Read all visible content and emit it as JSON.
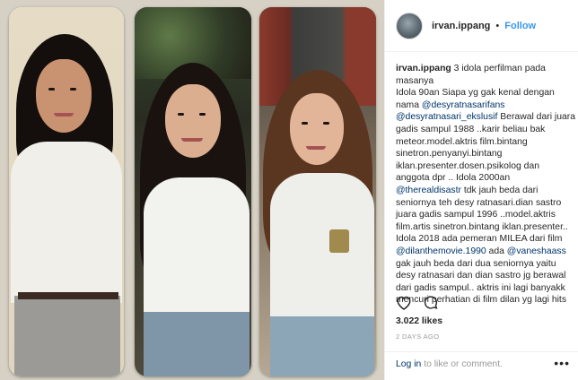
{
  "post": {
    "username": "irvan.ippang",
    "separator": "•",
    "follow_label": "Follow",
    "caption_user": "irvan.ippang",
    "caption_parts": [
      {
        "t": " 3 idola perfilman pada masanya\nIdola 90an Siapa yg gak kenal dengan nama ",
        "m": false
      },
      {
        "t": "@desyratnasarifans",
        "m": true
      },
      {
        "t": "\n",
        "m": false
      },
      {
        "t": "@desyratnasari_ekslusif",
        "m": true
      },
      {
        "t": " Berawal dari juara gadis sampul 1988 ..karir beliau bak meteor.model.aktris film.bintang sinetron.penyanyi.bintang iklan.presenter.dosen.psikolog dan anggota dpr .. Idola 2000an\n",
        "m": false
      },
      {
        "t": "@therealdisastr",
        "m": true
      },
      {
        "t": " tdk jauh beda dari seniornya teh desy ratnasari.dian sastro juara gadis sampul 1996 ..model.aktris film.artis sinetron.bintang iklan.presenter..\nIdola 2018 ada pemeran MILEA dari film\n",
        "m": false
      },
      {
        "t": "@dilanthemovie.1990",
        "m": true
      },
      {
        "t": " ada ",
        "m": false
      },
      {
        "t": "@vaneshaass",
        "m": true
      },
      {
        "t": "\ngak jauh beda dari dua seniornya yaitu desy ratnasari dan dian sastro jg berawal dari gadis sampul.. aktris ini lagi banyakk mencuri perhatian di film dilan yg lagi hits",
        "m": false
      }
    ],
    "likes": "3.022 likes",
    "date": "2 DAYS AGO",
    "login_link": "Log in",
    "login_text": " to like or comment.",
    "more_label": "•••"
  },
  "icons": [
    "heart-icon",
    "comment-icon",
    "more-icon"
  ],
  "colors": {
    "link": "#003569",
    "follow": "#3897f0",
    "muted": "#999999",
    "text": "#262626"
  }
}
